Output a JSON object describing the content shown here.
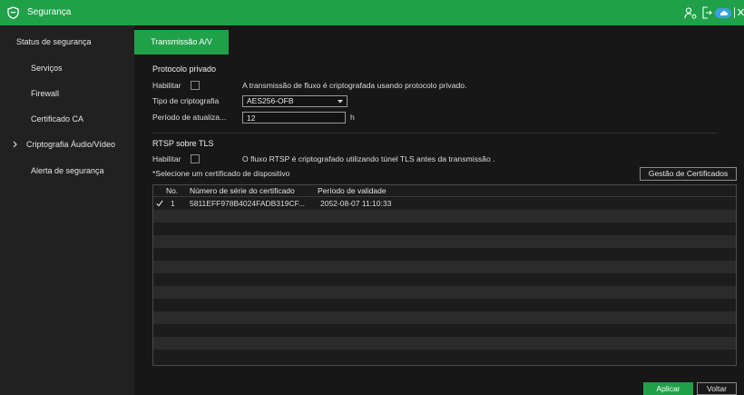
{
  "header": {
    "title": "Segurança",
    "title_icon": "shield-icon",
    "account_icon": "user-icon",
    "logout_icon": "logout-icon",
    "cloud_icon": "cloud-icon",
    "close_icon": "close-icon"
  },
  "colors": {
    "accent_green": "#20a049",
    "background": "#171717",
    "sidebar_background": "#212121",
    "cloud_blue": "#3d9fe2",
    "table_stripe_light": "#2b2b2b"
  },
  "sidebar": {
    "items": [
      {
        "label": "Status de segurança",
        "selected": false
      },
      {
        "label": "Serviços",
        "selected": false
      },
      {
        "label": "Firewall",
        "selected": false
      },
      {
        "label": "Certificado CA",
        "selected": false
      },
      {
        "label": "Criptografia Áudio/Vídeo",
        "selected": true,
        "icon": "chevron-right-icon"
      },
      {
        "label": "Alerta de segurança",
        "selected": false
      }
    ]
  },
  "tabs": [
    {
      "label": "Transmissão A/V",
      "active": true
    }
  ],
  "private_protocol": {
    "section_title": "Protocolo privado",
    "enable_label": "Habilitar",
    "enabled": false,
    "description": "A transmissão de fluxo é criptografada usando protocolo privado.",
    "encryption_type_label": "Tipo de criptografia",
    "encryption_type_value": "AES256-OFB",
    "encryption_type_icon": "dropdown-arrow-icon",
    "update_period_label": "Período de atualiza...",
    "update_period_value": "12",
    "update_period_unit": "h"
  },
  "rtsp_tls": {
    "section_title": "RTSP sobre TLS",
    "enable_label": "Habilitar",
    "enabled": false,
    "description": "O fluxo RTSP é criptografado utilizando túnel TLS antes da transmissão .",
    "select_hint": "*Selecione um certificado de dispositivo",
    "manage_button": "Gestão de Certificados"
  },
  "certificates_table": {
    "columns": [
      "No.",
      "Número de série do certificado",
      "Período de validade"
    ],
    "rows": [
      {
        "selected": true,
        "selected_icon": "check-icon",
        "no": "1",
        "serial": "5811EFF978B4024FADB319CF...",
        "validity": "2052-08-07 11:10:33"
      }
    ]
  },
  "footer": {
    "apply_label": "Aplicar",
    "back_label": "Voltar"
  }
}
